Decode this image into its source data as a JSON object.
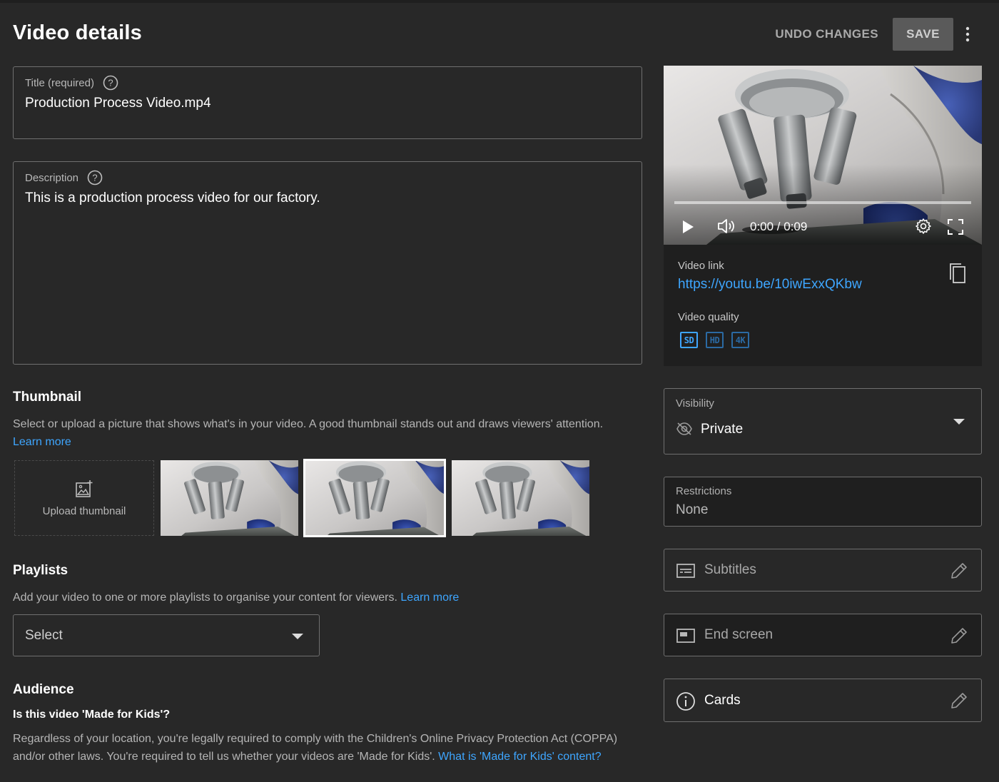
{
  "header": {
    "title": "Video details",
    "undo_label": "UNDO CHANGES",
    "save_label": "SAVE"
  },
  "title_field": {
    "label": "Title (required)",
    "value": "Production Process Video.mp4"
  },
  "description_field": {
    "label": "Description",
    "value": "This is a production process video for our factory."
  },
  "thumbnail": {
    "heading": "Thumbnail",
    "text": "Select or upload a picture that shows what's in your video. A good thumbnail stands out and draws viewers' attention.",
    "learn_more": "Learn more",
    "upload_label": "Upload thumbnail",
    "selected_index": 1
  },
  "playlists": {
    "heading": "Playlists",
    "text": "Add your video to one or more playlists to organise your content for viewers.",
    "learn_more": "Learn more",
    "select_value": "Select"
  },
  "audience": {
    "heading": "Audience",
    "question": "Is this video 'Made for Kids'?",
    "text_line1": "Regardless of your location, you're legally required to comply with the Children's Online Privacy Protection Act (COPPA)",
    "text_line2": "and/or other laws. You're required to tell us whether your videos are 'Made for Kids'.",
    "link": "What is 'Made for Kids' content?"
  },
  "player": {
    "time": "0:00 / 0:09",
    "progress": 0,
    "link_label": "Video link",
    "link_url": "https://youtu.be/10iwExxQKbw",
    "quality_label": "Video quality",
    "qualities": [
      "SD",
      "HD",
      "4K"
    ]
  },
  "visibility": {
    "label": "Visibility",
    "value": "Private"
  },
  "restrictions": {
    "label": "Restrictions",
    "value": "None"
  },
  "subtitles": {
    "label": "Subtitles"
  },
  "end_screen": {
    "label": "End screen"
  },
  "cards": {
    "label": "Cards"
  },
  "colors": {
    "background": "#282828",
    "panel": "#1f1f1f",
    "accent_link": "#3ea6ff",
    "border": "#6f6f6f"
  },
  "icons": {
    "help": "help-circle-icon",
    "more": "more-vertical-icon",
    "add_photo": "add-photo-icon",
    "play": "play-icon",
    "volume": "volume-icon",
    "settings": "gear-icon",
    "fullscreen": "fullscreen-icon",
    "copy": "copy-icon",
    "visibility": "eye-off-icon",
    "subtitles": "subtitles-icon",
    "end_screen": "end-screen-icon",
    "cards": "info-icon",
    "edit": "pencil-icon"
  }
}
